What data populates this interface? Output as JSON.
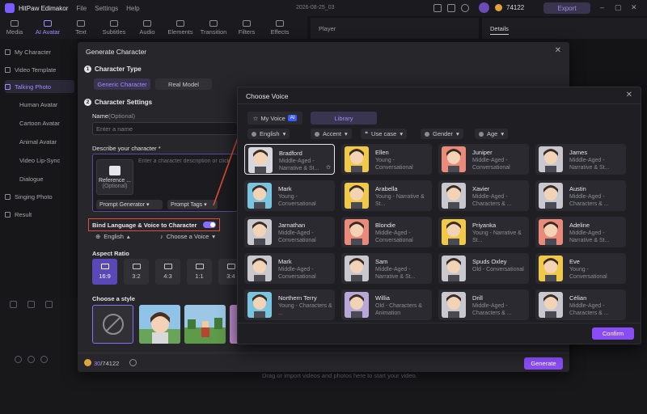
{
  "app": {
    "name": "HitPaw Edimakor",
    "menu": [
      "File",
      "Settings",
      "Help"
    ],
    "project": "2026-08-25_03",
    "credits": "74122",
    "export_label": "Export"
  },
  "tools": [
    {
      "label": "Media",
      "active": false
    },
    {
      "label": "AI Avatar",
      "active": true
    },
    {
      "label": "Text",
      "active": false
    },
    {
      "label": "Subtitles",
      "active": false
    },
    {
      "label": "Audio",
      "active": false
    },
    {
      "label": "Elements",
      "active": false
    },
    {
      "label": "Transition",
      "active": false
    },
    {
      "label": "Filters",
      "active": false
    },
    {
      "label": "Effects",
      "active": false
    }
  ],
  "player_label": "Player",
  "details_label": "Details",
  "sidebar": {
    "items": [
      {
        "label": "My Character"
      },
      {
        "label": "Video Template"
      },
      {
        "label": "Talking Photo"
      },
      {
        "label": "Human Avatar"
      },
      {
        "label": "Cartoon Avatar"
      },
      {
        "label": "Animal Avatar"
      },
      {
        "label": "Video Lip-Sync"
      },
      {
        "label": "Dialogue"
      },
      {
        "label": "Singing Photo"
      },
      {
        "label": "Result"
      }
    ]
  },
  "timeline": {
    "drop_text": "Drag or import videos and photos here to start your video."
  },
  "generate": {
    "title": "Generate Character",
    "section1": "Character Type",
    "type_generic": "Generic Character",
    "type_real": "Real Model",
    "section2": "Character Settings",
    "name_label": "Name",
    "name_optional": "(Optional)",
    "name_placeholder": "Enter a name",
    "describe_label": "Describe your character *",
    "describe_placeholder": "Enter a character description or click",
    "reference_label": "Reference ...",
    "reference_optional": "(Optional)",
    "prompt_generator": "Prompt Generator",
    "prompt_tags": "Prompt Tags",
    "bind_label": "Bind Language & Voice to Character",
    "language": "English",
    "voice": "Choose a Voice",
    "aspect_label": "Aspect Ratio",
    "aspects": [
      {
        "label": "16:9",
        "active": true
      },
      {
        "label": "3:2",
        "active": false
      },
      {
        "label": "4:3",
        "active": false
      },
      {
        "label": "1:1",
        "active": false
      },
      {
        "label": "3:4",
        "active": false
      }
    ],
    "style_label": "Choose a style",
    "credit_used": "30",
    "credit_total": "/74122",
    "generate_label": "Generate"
  },
  "voice_dialog": {
    "title": "Choose Voice",
    "tab_my": "My Voice",
    "ai_badge": "AI",
    "tab_library": "Library",
    "filters": [
      "English",
      "Accent",
      "Use case",
      "Gender",
      "Age"
    ],
    "voices": [
      {
        "name": "Bradford",
        "desc": "Middle-Aged - Narrative & St...",
        "color": "#d8d8dc",
        "selected": true
      },
      {
        "name": "Ellen",
        "desc": "Young - Conversational",
        "color": "#f0c84a",
        "selected": false
      },
      {
        "name": "Juniper",
        "desc": "Middle-Aged - Conversational",
        "color": "#e98a7a",
        "selected": false
      },
      {
        "name": "James",
        "desc": "Middle-Aged - Narrative & St...",
        "color": "#c8c8ce",
        "selected": false
      },
      {
        "name": "Mark",
        "desc": "Young - Conversational",
        "color": "#7bc4e0",
        "selected": false
      },
      {
        "name": "Arabella",
        "desc": "Young - Narrative & St...",
        "color": "#f0c84a",
        "selected": false
      },
      {
        "name": "Xavier",
        "desc": "Middle-Aged - Characters & ...",
        "color": "#c8c8ce",
        "selected": false
      },
      {
        "name": "Austin",
        "desc": "Middle-Aged - Characters & ...",
        "color": "#c8c8ce",
        "selected": false
      },
      {
        "name": "Jarnathan",
        "desc": "Middle-Aged - Conversational",
        "color": "#c8c8ce",
        "selected": false
      },
      {
        "name": "Blondie",
        "desc": "Middle-Aged - Conversational",
        "color": "#e98a7a",
        "selected": false
      },
      {
        "name": "Priyanka",
        "desc": "Young - Narrative & St...",
        "color": "#f0c84a",
        "selected": false
      },
      {
        "name": "Adeline",
        "desc": "Middle-Aged - Narrative & St...",
        "color": "#e98a7a",
        "selected": false
      },
      {
        "name": "Mark",
        "desc": "Middle-Aged - Conversational",
        "color": "#c8c8ce",
        "selected": false
      },
      {
        "name": "Sam",
        "desc": "Middle-Aged - Narrative & St...",
        "color": "#c8c8ce",
        "selected": false
      },
      {
        "name": "Spuds Oxley",
        "desc": "Old - Conversational",
        "color": "#c8c8ce",
        "selected": false
      },
      {
        "name": "Eve",
        "desc": "Young - Conversational",
        "color": "#f0c84a",
        "selected": false
      },
      {
        "name": "Northern Terry",
        "desc": "Young - Characters & ...",
        "color": "#7bc4e0",
        "selected": false
      },
      {
        "name": "Willia",
        "desc": "Old - Characters & Animation",
        "color": "#b8a8d8",
        "selected": false
      },
      {
        "name": "Drill",
        "desc": "Middle-Aged - Characters & ...",
        "color": "#c8c8ce",
        "selected": false
      },
      {
        "name": "Célian",
        "desc": "Middle-Aged - Characters & ...",
        "color": "#c8c8ce",
        "selected": false
      }
    ],
    "confirm_label": "Confirm"
  },
  "colors": {
    "accent": "#8a4cf5",
    "highlight_red": "#e24b35"
  }
}
